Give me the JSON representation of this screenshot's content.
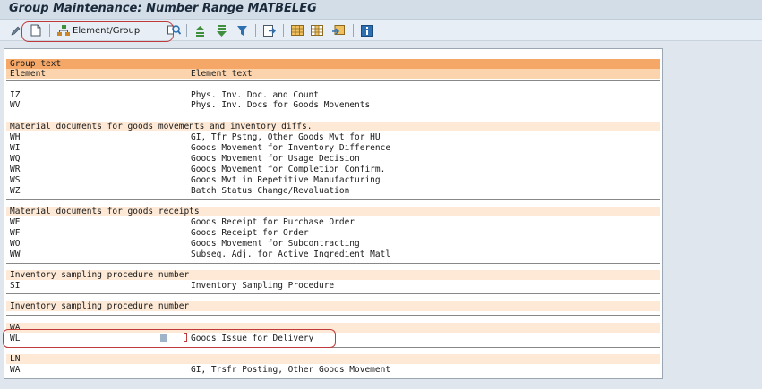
{
  "window": {
    "title": "Group Maintenance: Number Range MATBELEG"
  },
  "toolbar": {
    "element_group_label": "Element/Group"
  },
  "table": {
    "header_group": "Group text",
    "header_element": "Element",
    "header_element_text": "Element text",
    "groups": [
      {
        "text": "",
        "rows": [
          {
            "element": "IZ",
            "text": "Phys. Inv. Doc. and Count"
          },
          {
            "element": "WV",
            "text": "Phys. Inv. Docs for Goods Movements"
          }
        ]
      },
      {
        "text": "Material documents for goods movements and inventory diffs.",
        "rows": [
          {
            "element": "WH",
            "text": "GI, Tfr Pstng, Other Goods Mvt for HU"
          },
          {
            "element": "WI",
            "text": "Goods Movement for Inventory Difference"
          },
          {
            "element": "WQ",
            "text": "Goods Movement for Usage Decision"
          },
          {
            "element": "WR",
            "text": "Goods Movement for Completion Confirm."
          },
          {
            "element": "WS",
            "text": "Goods Mvt in Repetitive Manufacturing"
          },
          {
            "element": "WZ",
            "text": "Batch Status Change/Revaluation"
          }
        ]
      },
      {
        "text": "Material documents for goods receipts",
        "rows": [
          {
            "element": "WE",
            "text": "Goods Receipt for Purchase Order"
          },
          {
            "element": "WF",
            "text": "Goods Receipt for Order"
          },
          {
            "element": "WO",
            "text": "Goods Movement for Subcontracting"
          },
          {
            "element": "WW",
            "text": "Subseq. Adj. for Active Ingredient Matl"
          }
        ]
      },
      {
        "text": "Inventory sampling procedure number",
        "rows": [
          {
            "element": "SI",
            "text": "Inventory Sampling Procedure"
          }
        ]
      },
      {
        "text": "Inventory sampling procedure number",
        "rows": []
      },
      {
        "text": "WA",
        "rows": [
          {
            "element": "WL",
            "text": "Goods Issue for Delivery"
          }
        ]
      },
      {
        "text": "LN",
        "rows": [
          {
            "element": "WA",
            "text": "GI, Trsfr Posting, Other Goods Movement"
          }
        ]
      }
    ]
  },
  "colors": {
    "header_group": "#f4a767",
    "header_cols": "#fbd4ae",
    "group_head": "#fde9d6",
    "highlight": "#c0393b"
  }
}
